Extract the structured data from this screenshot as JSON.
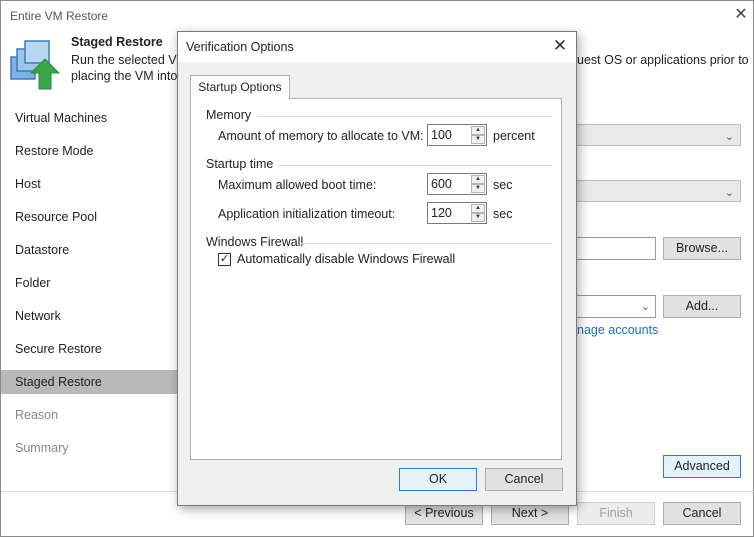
{
  "window": {
    "title": "Entire VM Restore",
    "close_glyph": "✕"
  },
  "header": {
    "title": "Staged Restore",
    "desc_line1": "Run the selected VM",
    "desc_line2": "placing the VM into",
    "desc_right": "uest OS or applications prior to"
  },
  "sidebar": {
    "items": [
      {
        "label": "Virtual Machines"
      },
      {
        "label": "Restore Mode"
      },
      {
        "label": "Host"
      },
      {
        "label": "Resource Pool"
      },
      {
        "label": "Datastore"
      },
      {
        "label": "Folder"
      },
      {
        "label": "Network"
      },
      {
        "label": "Secure Restore"
      },
      {
        "label": "Staged Restore"
      },
      {
        "label": "Reason"
      },
      {
        "label": "Summary"
      }
    ],
    "active_index": 8
  },
  "main": {
    "browse_label": "Browse...",
    "add_label": "Add...",
    "manage_accounts_link": "nage accounts",
    "advanced_label": "Advanced"
  },
  "footer": {
    "previous_label": "< Previous",
    "next_label": "Next >",
    "finish_label": "Finish",
    "cancel_label": "Cancel"
  },
  "dialog": {
    "title": "Verification Options",
    "close_glyph": "✕",
    "tab_label": "Startup Options",
    "memory": {
      "group_label": "Memory",
      "field_label": "Amount of memory to allocate to VM:",
      "value": "100",
      "unit": "percent"
    },
    "startup_time": {
      "group_label": "Startup time",
      "boot_label": "Maximum allowed boot time:",
      "boot_value": "600",
      "boot_unit": "sec",
      "app_label": "Application initialization timeout:",
      "app_value": "120",
      "app_unit": "sec"
    },
    "firewall": {
      "group_label": "Windows Firewall",
      "checkbox_label": "Automatically disable Windows Firewall",
      "checked": true
    },
    "ok_label": "OK",
    "cancel_label": "Cancel"
  },
  "colors": {
    "accent": "#2f7bd6",
    "link": "#1a6fc9",
    "sidebar_active": "#b9b9b9"
  }
}
